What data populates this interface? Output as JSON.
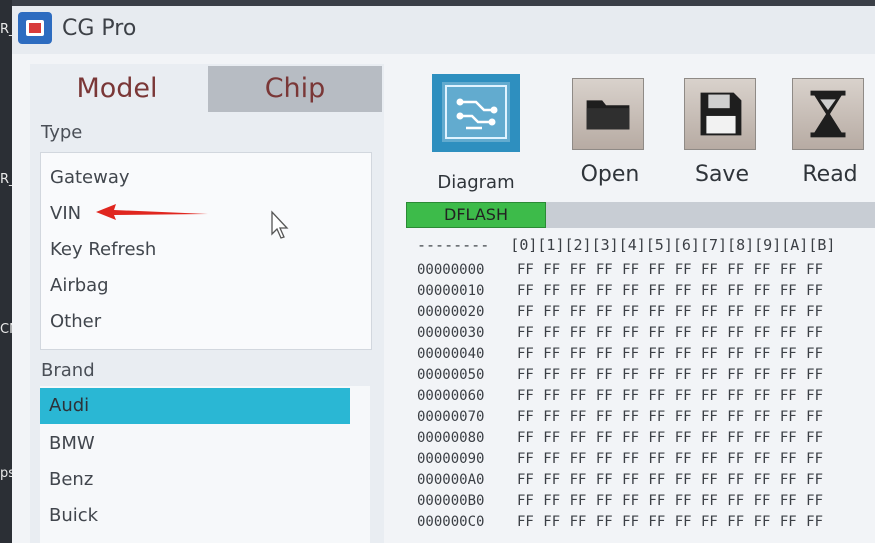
{
  "desktop": {
    "left_labels": [
      "R_",
      "R_",
      "CN",
      "psip"
    ]
  },
  "window": {
    "title": "CG Pro",
    "icon": "chip-app-icon"
  },
  "tabs": [
    {
      "label": "Model",
      "active": true
    },
    {
      "label": "Chip",
      "active": false
    }
  ],
  "type_section": {
    "label": "Type",
    "items": [
      "Gateway",
      "VIN",
      "Key Refresh",
      "Airbag",
      "Other"
    ],
    "annotated_item": "VIN"
  },
  "brand_section": {
    "label": "Brand",
    "items": [
      "Audi",
      "BMW",
      "Benz",
      "Buick"
    ],
    "selected": "Audi"
  },
  "toolbar": {
    "diagram_label": "Diagram",
    "open_label": "Open",
    "save_label": "Save",
    "read_label": "Read"
  },
  "memory": {
    "region_label": "DFLASH",
    "header_dashes": "--------",
    "columns": [
      "0",
      "1",
      "2",
      "3",
      "4",
      "5",
      "6",
      "7",
      "8",
      "9",
      "A",
      "B"
    ],
    "addresses": [
      "00000000",
      "00000010",
      "00000020",
      "00000030",
      "00000040",
      "00000050",
      "00000060",
      "00000070",
      "00000080",
      "00000090",
      "000000A0",
      "000000B0",
      "000000C0"
    ],
    "row_bytes": "FF FF FF FF FF FF FF FF FF FF FF FF"
  },
  "colors": {
    "selected_brand": "#2ab7d4",
    "dflash_green": "#3dbb4a",
    "annotation_arrow": "#e0261f"
  }
}
